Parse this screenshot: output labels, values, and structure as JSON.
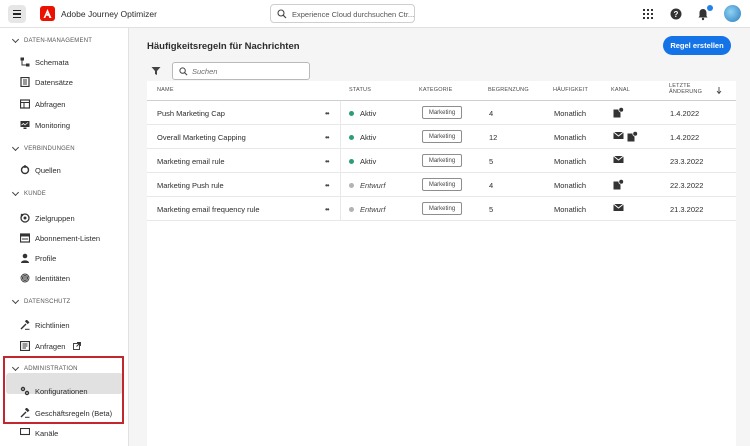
{
  "header": {
    "app_title": "Adobe Journey Optimizer",
    "search_placeholder": "Experience Cloud durchsuchen Ctr..."
  },
  "sidebar": {
    "sections": [
      {
        "title": "DATEN-MANAGEMENT",
        "items": [
          "Schemata",
          "Datensätze",
          "Abfragen",
          "Monitoring"
        ]
      },
      {
        "title": "VERBINDUNGEN",
        "items": [
          "Quellen"
        ]
      },
      {
        "title": "KUNDE",
        "items": [
          "Zielgruppen",
          "Abonnement-Listen",
          "Profile",
          "Identitäten"
        ]
      },
      {
        "title": "DATENSCHUTZ",
        "items": [
          "Richtlinien",
          "Anfragen"
        ]
      },
      {
        "title": "ADMINISTRATION",
        "items": [
          "Konfigurationen",
          "Geschäftsregeln (Beta)",
          "Kanäle"
        ]
      }
    ],
    "active_item": "Geschäftsregeln (Beta)"
  },
  "main": {
    "title": "Häufigkeitsregeln für Nachrichten",
    "create_button": "Regel erstellen",
    "search_placeholder": "Suchen",
    "columns": {
      "name": "NAME",
      "status": "STATUS",
      "category": "KATEGORIE",
      "limit": "BEGRENZUNG",
      "frequency": "HÄUFIGKEIT",
      "channel": "KANAL",
      "last_change_1": "LETZTE",
      "last_change_2": "ÄNDERUNG"
    },
    "rows": [
      {
        "name": "Push Marketing Cap",
        "status": "Aktiv",
        "category": "Marketing",
        "limit": "4",
        "frequency": "Monatlich",
        "channels": [
          "push"
        ],
        "date": "1.4.2022"
      },
      {
        "name": "Overall Marketing Capping",
        "status": "Aktiv",
        "category": "Marketing",
        "limit": "12",
        "frequency": "Monatlich",
        "channels": [
          "email",
          "push"
        ],
        "date": "1.4.2022"
      },
      {
        "name": "Marketing email rule",
        "status": "Aktiv",
        "category": "Marketing",
        "limit": "5",
        "frequency": "Monatlich",
        "channels": [
          "email"
        ],
        "date": "23.3.2022"
      },
      {
        "name": "Marketing Push rule",
        "status": "Entwurf",
        "category": "Marketing",
        "limit": "4",
        "frequency": "Monatlich",
        "channels": [
          "push"
        ],
        "date": "22.3.2022"
      },
      {
        "name": "Marketing email frequency rule",
        "status": "Entwurf",
        "category": "Marketing",
        "limit": "5",
        "frequency": "Monatlich",
        "channels": [
          "email"
        ],
        "date": "21.3.2022"
      }
    ]
  },
  "colors": {
    "accent": "#1473e6",
    "active_status": "#2d9d78",
    "draft_status": "#b3b3b3",
    "brand": "#eb1000",
    "highlight_border": "#c1272d"
  }
}
